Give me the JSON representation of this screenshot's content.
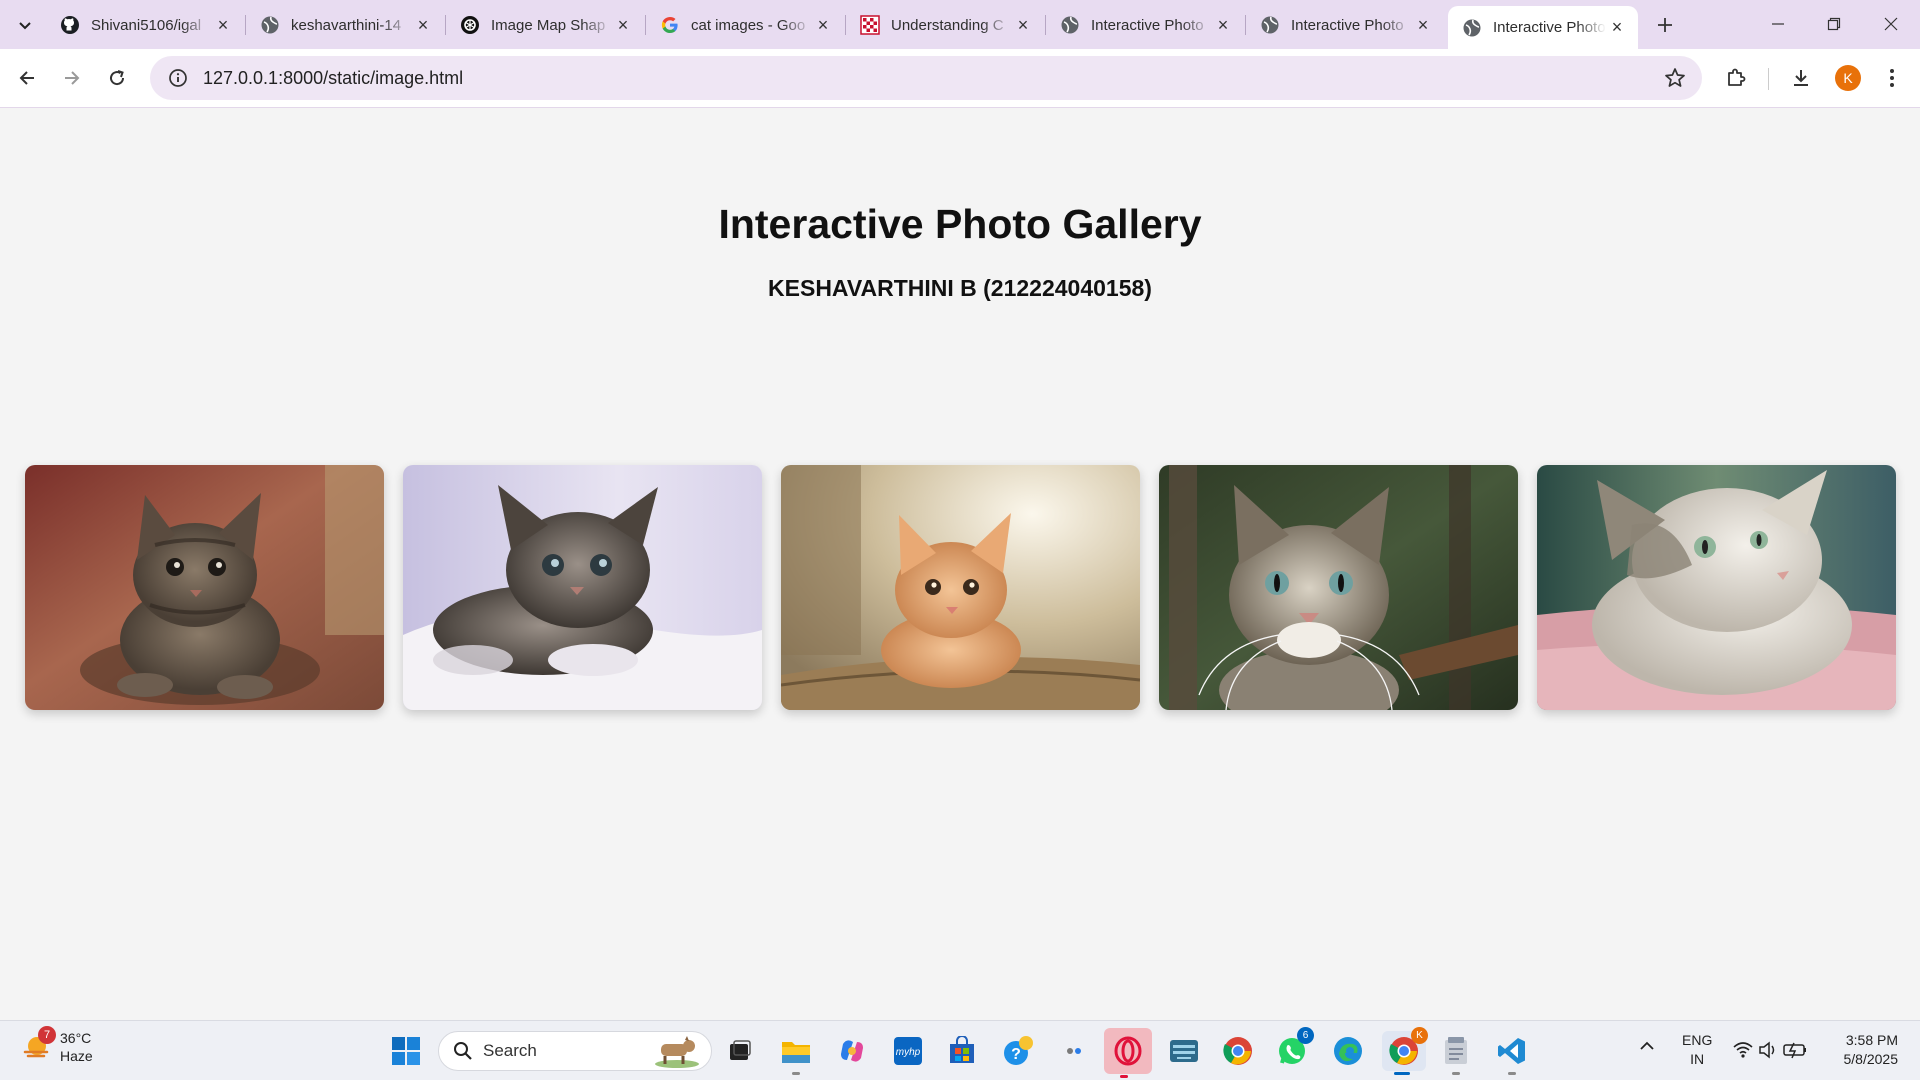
{
  "tabs": [
    {
      "title": "Shivani5106/igal",
      "icon": "github-icon"
    },
    {
      "title": "keshavarthini-14",
      "icon": "globe-icon"
    },
    {
      "title": "Image Map Shap",
      "icon": "openai-icon"
    },
    {
      "title": "cat images - Goo",
      "icon": "google-icon"
    },
    {
      "title": "Understanding C",
      "icon": "checker-icon"
    },
    {
      "title": "Interactive Photo",
      "icon": "globe-icon"
    },
    {
      "title": "Interactive Photo",
      "icon": "globe-icon"
    },
    {
      "title": "Interactive Photo",
      "icon": "globe-icon",
      "active": true
    }
  ],
  "address_bar": {
    "url": "127.0.0.1:8000/static/image.html"
  },
  "profile": {
    "initial": "K",
    "color": "#e8710a"
  },
  "page": {
    "title": "Interactive Photo Gallery",
    "subtitle": "KESHAVARTHINI B (212224040158)",
    "photos": [
      {
        "subject": "tabby kitten on wooden floor"
      },
      {
        "subject": "fluffy tabby kitten on white blanket"
      },
      {
        "subject": "orange kitten in sunlight"
      },
      {
        "subject": "tabby cat with long whiskers"
      },
      {
        "subject": "white and grey cat on pink rug"
      }
    ]
  },
  "taskbar": {
    "weather": {
      "temp": "36°C",
      "condition": "Haze",
      "badge": "7"
    },
    "search_placeholder": "Search",
    "whatsapp_badge": "6",
    "chrome_badge": "K",
    "language": {
      "line1": "ENG",
      "line2": "IN"
    },
    "clock": {
      "time": "3:58 PM",
      "date": "5/8/2025"
    }
  },
  "colors": {
    "tabstrip": "#e8dcf1",
    "omnibox": "#efe6f4",
    "page_bg": "#f4f4f4",
    "taskbar": "#eef0f5"
  }
}
